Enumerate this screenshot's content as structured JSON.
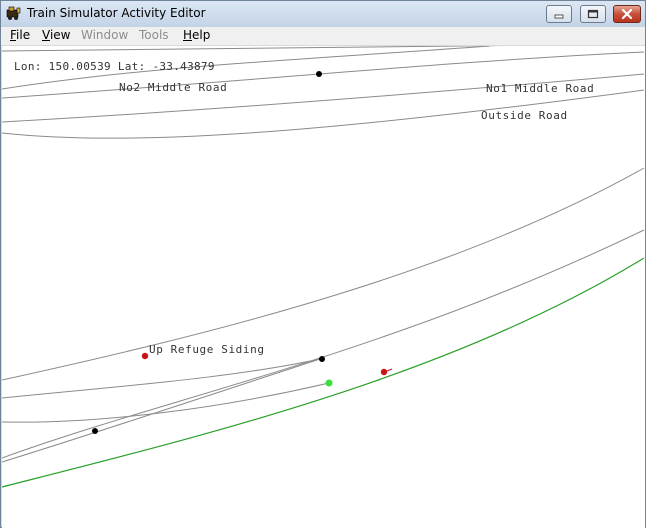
{
  "window": {
    "title": "Train Simulator Activity Editor"
  },
  "menu": {
    "file": {
      "accel": "F",
      "rest": "ile"
    },
    "view": {
      "accel": "V",
      "rest": "iew"
    },
    "window": "Window",
    "tools": "Tools",
    "help": {
      "accel": "H",
      "rest": "elp"
    }
  },
  "status": {
    "coords": "Lon: 150.00539 Lat: -33.43879"
  },
  "tracks": {
    "no2_middle_road": "No2 Middle Road",
    "no1_middle_road": "No1 Middle Road",
    "outside_road": "Outside Road",
    "up_refuge_siding": "Up Refuge Siding"
  },
  "colors": {
    "track": "#8a8a8a",
    "selected_track": "#2aa02a",
    "junction": "#000000",
    "signal": "#c81414",
    "cursor": "#3be03b"
  }
}
